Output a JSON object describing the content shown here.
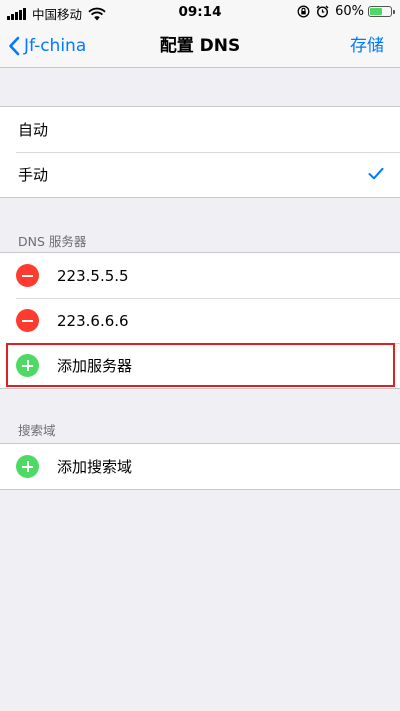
{
  "status_bar": {
    "carrier": "中国移动",
    "time": "09:14",
    "battery_percent": "60%",
    "battery_level": 0.6,
    "icons": [
      "signal-icon",
      "wifi-icon",
      "rotation-lock-icon",
      "alarm-icon",
      "battery-icon"
    ]
  },
  "nav": {
    "back_label": "Jf-china",
    "title": "配置 DNS",
    "save_label": "存储"
  },
  "config_mode": {
    "options": [
      {
        "label": "自动",
        "selected": false
      },
      {
        "label": "手动",
        "selected": true
      }
    ]
  },
  "dns_section": {
    "header": "DNS 服务器",
    "servers": [
      "223.5.5.5",
      "223.6.6.6"
    ],
    "add_label": "添加服务器"
  },
  "search_section": {
    "header": "搜索域",
    "add_label": "添加搜索域"
  },
  "colors": {
    "accent": "#007aff",
    "delete": "#ff3b30",
    "add": "#4cd964",
    "highlight": "#e02020",
    "background": "#efeff4"
  }
}
